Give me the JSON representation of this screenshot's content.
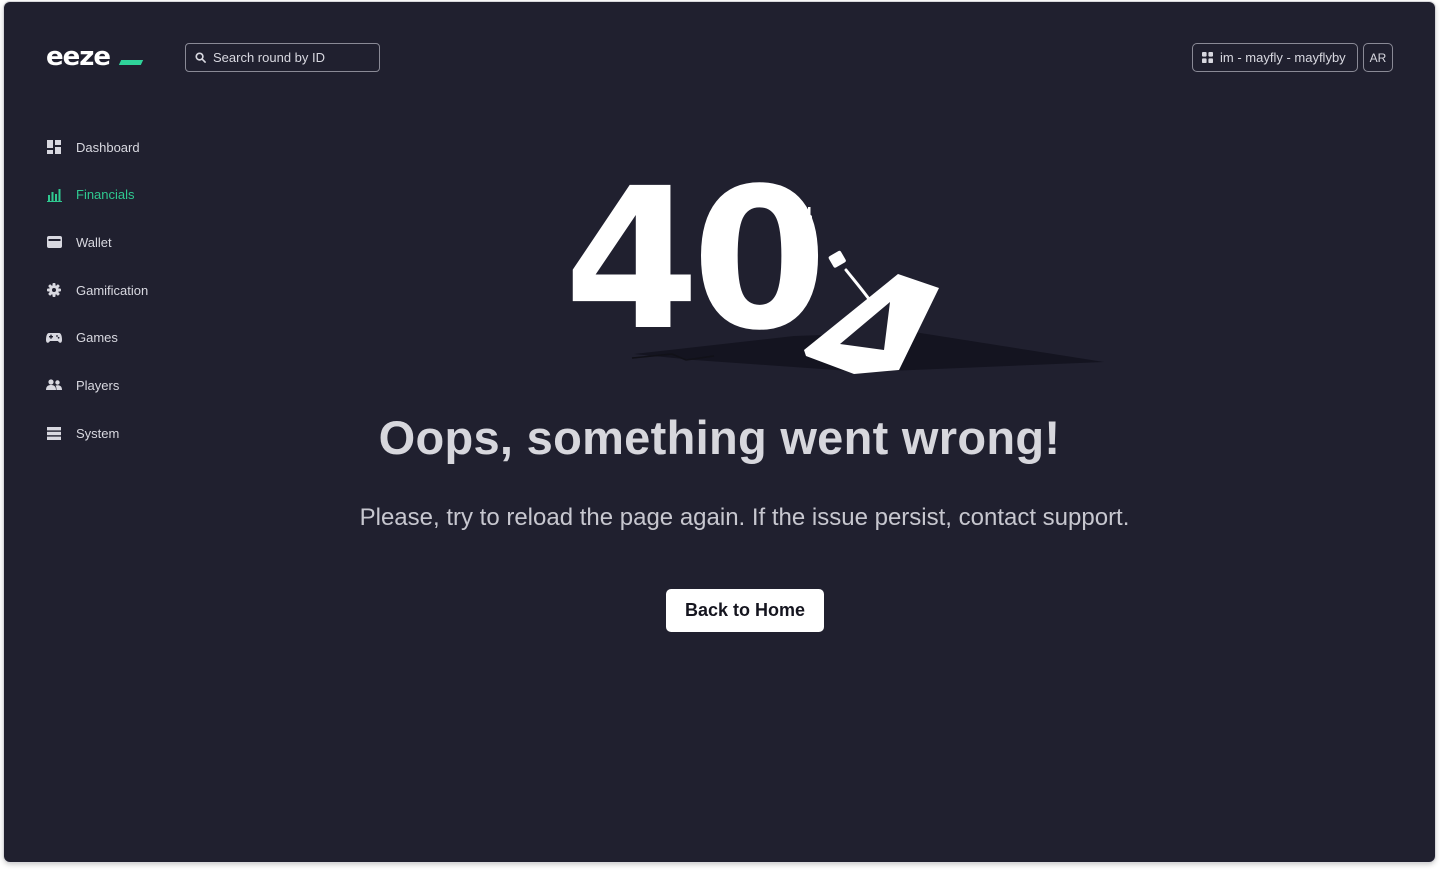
{
  "app": {
    "logo_text": "eeze",
    "brand_color": "#2fd39a",
    "background_color": "#20202f"
  },
  "header": {
    "search": {
      "placeholder": "Search round by ID",
      "icon": "search-icon"
    },
    "org_selector": {
      "label": "im - mayfly - mayflyby",
      "icon": "grid-icon"
    },
    "language": "AR"
  },
  "sidebar": {
    "items": [
      {
        "label": "Dashboard",
        "icon": "dashboard-icon",
        "active": false
      },
      {
        "label": "Financials",
        "icon": "bar-chart-icon",
        "active": true
      },
      {
        "label": "Wallet",
        "icon": "wallet-icon",
        "active": false
      },
      {
        "label": "Gamification",
        "icon": "gear-icon",
        "active": false
      },
      {
        "label": "Games",
        "icon": "gamepad-icon",
        "active": false
      },
      {
        "label": "Players",
        "icon": "players-icon",
        "active": false
      },
      {
        "label": "System",
        "icon": "system-icon",
        "active": false
      }
    ]
  },
  "error": {
    "code_digits": "40",
    "title": "Oops, something went wrong!",
    "message": "Please, try to reload the page again. If the issue persist, contact support.",
    "button_label": "Back to Home"
  }
}
